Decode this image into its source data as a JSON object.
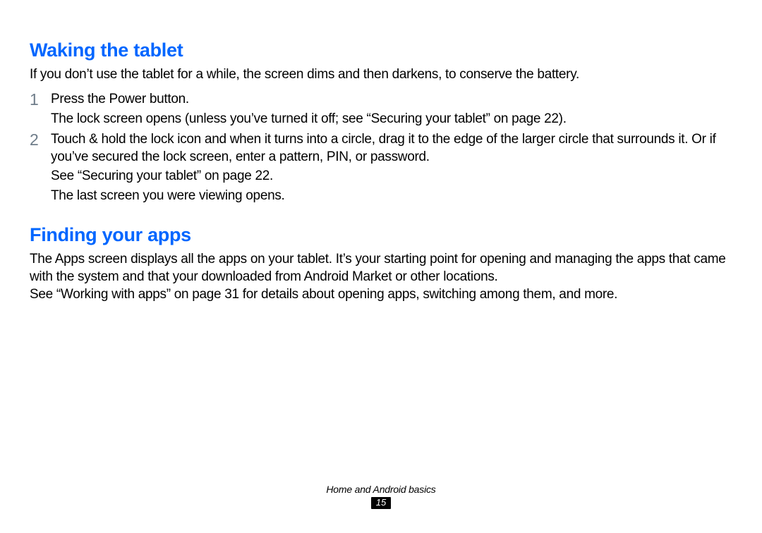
{
  "section1": {
    "heading": "Waking the tablet",
    "intro": "If you don’t use the tablet for a while, the screen dims and then darkens, to conserve the battery.",
    "steps": [
      {
        "num": "1",
        "lines": [
          "Press the Power button.",
          "The lock screen opens (unless you’ve turned it off; see “Securing your tablet” on page 22)."
        ]
      },
      {
        "num": "2",
        "lines": [
          "Touch & hold the lock icon and when it turns into a circle, drag it to the edge of the larger circle that surrounds it. Or if you’ve secured the lock screen, enter a pattern, PIN, or password.",
          "See “Securing your tablet” on page 22.",
          "The last screen you were viewing opens."
        ]
      }
    ]
  },
  "section2": {
    "heading": "Finding your apps",
    "paragraphs": [
      "The Apps screen displays all the apps on your tablet. It’s your starting point for opening and managing the apps that came with the system and that your downloaded from Android Market or other locations.",
      "See “Working with apps” on page 31 for details about opening apps, switching among them, and more."
    ]
  },
  "footer": {
    "chapter": "Home and Android basics",
    "page": "15"
  }
}
